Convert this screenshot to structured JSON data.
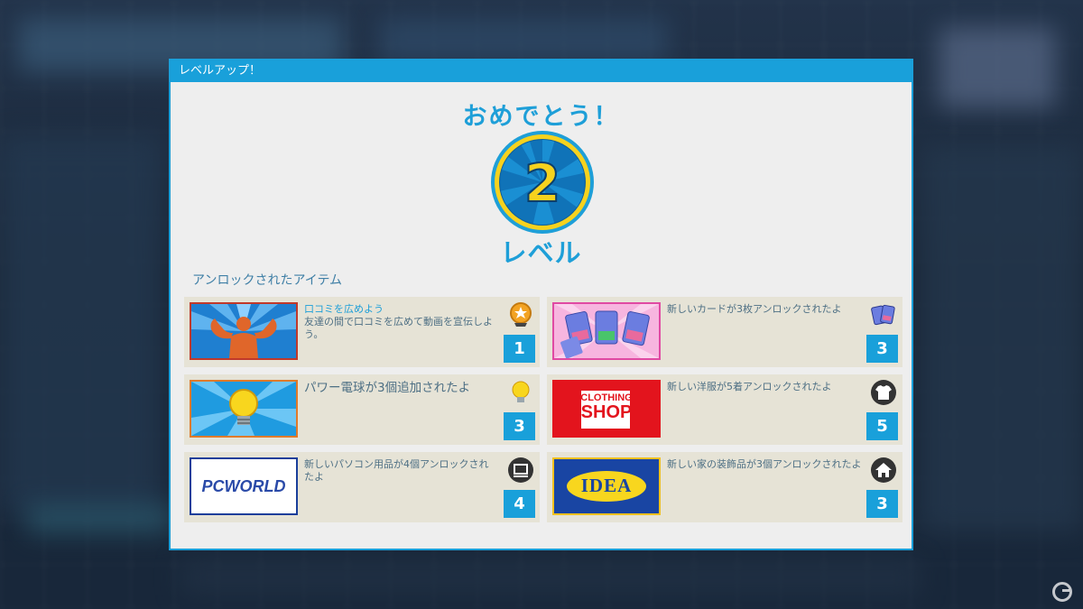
{
  "dialog": {
    "title": "レベルアップ！",
    "congrats": "おめでとう！",
    "level_number": "2",
    "level_word": "レベル",
    "section_label": "アンロックされたアイテム"
  },
  "items": [
    {
      "title": "口コミを広めよう",
      "description": "友達の間で口コミを広めて動画を宣伝しよう。",
      "count": "1",
      "thumb": "muscle-man",
      "icon": "star-medal-icon"
    },
    {
      "title": "",
      "description": "新しいカードが3枚アンロックされたよ",
      "count": "3",
      "thumb": "cards",
      "icon": "cards-icon"
    },
    {
      "title": "",
      "description": "パワー電球が3個追加されたよ",
      "count": "3",
      "thumb": "lightbulb",
      "icon": "lightbulb-icon"
    },
    {
      "title": "",
      "description": "新しい洋服が5着アンロックされたよ",
      "count": "5",
      "thumb": "clothing-shop-logo",
      "logo_text": [
        "CLOTHING",
        "SHOP"
      ],
      "icon": "shirt-icon"
    },
    {
      "title": "",
      "description": "新しいパソコン用品が4個アンロックされたよ",
      "count": "4",
      "thumb": "pcworld-logo",
      "logo_text": "PCWORLD",
      "icon": "computer-icon"
    },
    {
      "title": "",
      "description": "新しい家の装飾品が3個アンロックされたよ",
      "count": "3",
      "thumb": "idea-logo",
      "logo_text": "IDEA",
      "icon": "house-icon"
    }
  ],
  "colors": {
    "accent": "#19a0da",
    "badge_gold": "#f6d21e",
    "item_bg": "#e6e3d6"
  }
}
